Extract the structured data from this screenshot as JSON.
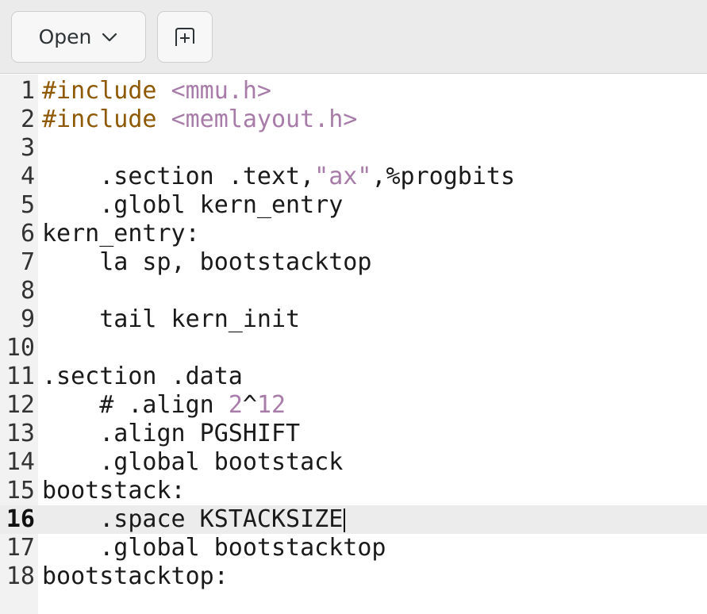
{
  "toolbar": {
    "open_label": "Open"
  },
  "colors": {
    "preprocessor": "#8f5902",
    "string": "#a87ca8",
    "number": "#a87ca8",
    "text": "#1a1a1a",
    "current_line_bg": "#ececec"
  },
  "editor": {
    "current_line": 16,
    "lines": [
      {
        "num": "1",
        "tokens": [
          {
            "t": "#include",
            "c": "preprocessor"
          },
          {
            "t": " ",
            "c": "text"
          },
          {
            "t": "<mmu.h>",
            "c": "string"
          }
        ]
      },
      {
        "num": "2",
        "tokens": [
          {
            "t": "#include",
            "c": "preprocessor"
          },
          {
            "t": " ",
            "c": "text"
          },
          {
            "t": "<memlayout.h>",
            "c": "string"
          }
        ]
      },
      {
        "num": "3",
        "tokens": []
      },
      {
        "num": "4",
        "tokens": [
          {
            "t": "    .section .text,",
            "c": "text"
          },
          {
            "t": "\"ax\"",
            "c": "string"
          },
          {
            "t": ",%progbits",
            "c": "text"
          }
        ]
      },
      {
        "num": "5",
        "tokens": [
          {
            "t": "    .globl kern_entry",
            "c": "text"
          }
        ]
      },
      {
        "num": "6",
        "tokens": [
          {
            "t": "kern_entry:",
            "c": "text"
          }
        ]
      },
      {
        "num": "7",
        "tokens": [
          {
            "t": "    la sp, bootstacktop",
            "c": "text"
          }
        ]
      },
      {
        "num": "8",
        "tokens": []
      },
      {
        "num": "9",
        "tokens": [
          {
            "t": "    tail kern_init",
            "c": "text"
          }
        ]
      },
      {
        "num": "10",
        "tokens": []
      },
      {
        "num": "11",
        "tokens": [
          {
            "t": ".section .data",
            "c": "text"
          }
        ]
      },
      {
        "num": "12",
        "tokens": [
          {
            "t": "    # .align ",
            "c": "text"
          },
          {
            "t": "2",
            "c": "number"
          },
          {
            "t": "^",
            "c": "text"
          },
          {
            "t": "12",
            "c": "number"
          }
        ]
      },
      {
        "num": "13",
        "tokens": [
          {
            "t": "    .align PGSHIFT",
            "c": "text"
          }
        ]
      },
      {
        "num": "14",
        "tokens": [
          {
            "t": "    .global bootstack",
            "c": "text"
          }
        ]
      },
      {
        "num": "15",
        "tokens": [
          {
            "t": "bootstack:",
            "c": "text"
          }
        ]
      },
      {
        "num": "16",
        "tokens": [
          {
            "t": "    .space KSTACKSIZE",
            "c": "text"
          }
        ]
      },
      {
        "num": "17",
        "tokens": [
          {
            "t": "    .global bootstacktop",
            "c": "text"
          }
        ]
      },
      {
        "num": "18",
        "tokens": [
          {
            "t": "bootstacktop:",
            "c": "text"
          }
        ]
      }
    ]
  }
}
